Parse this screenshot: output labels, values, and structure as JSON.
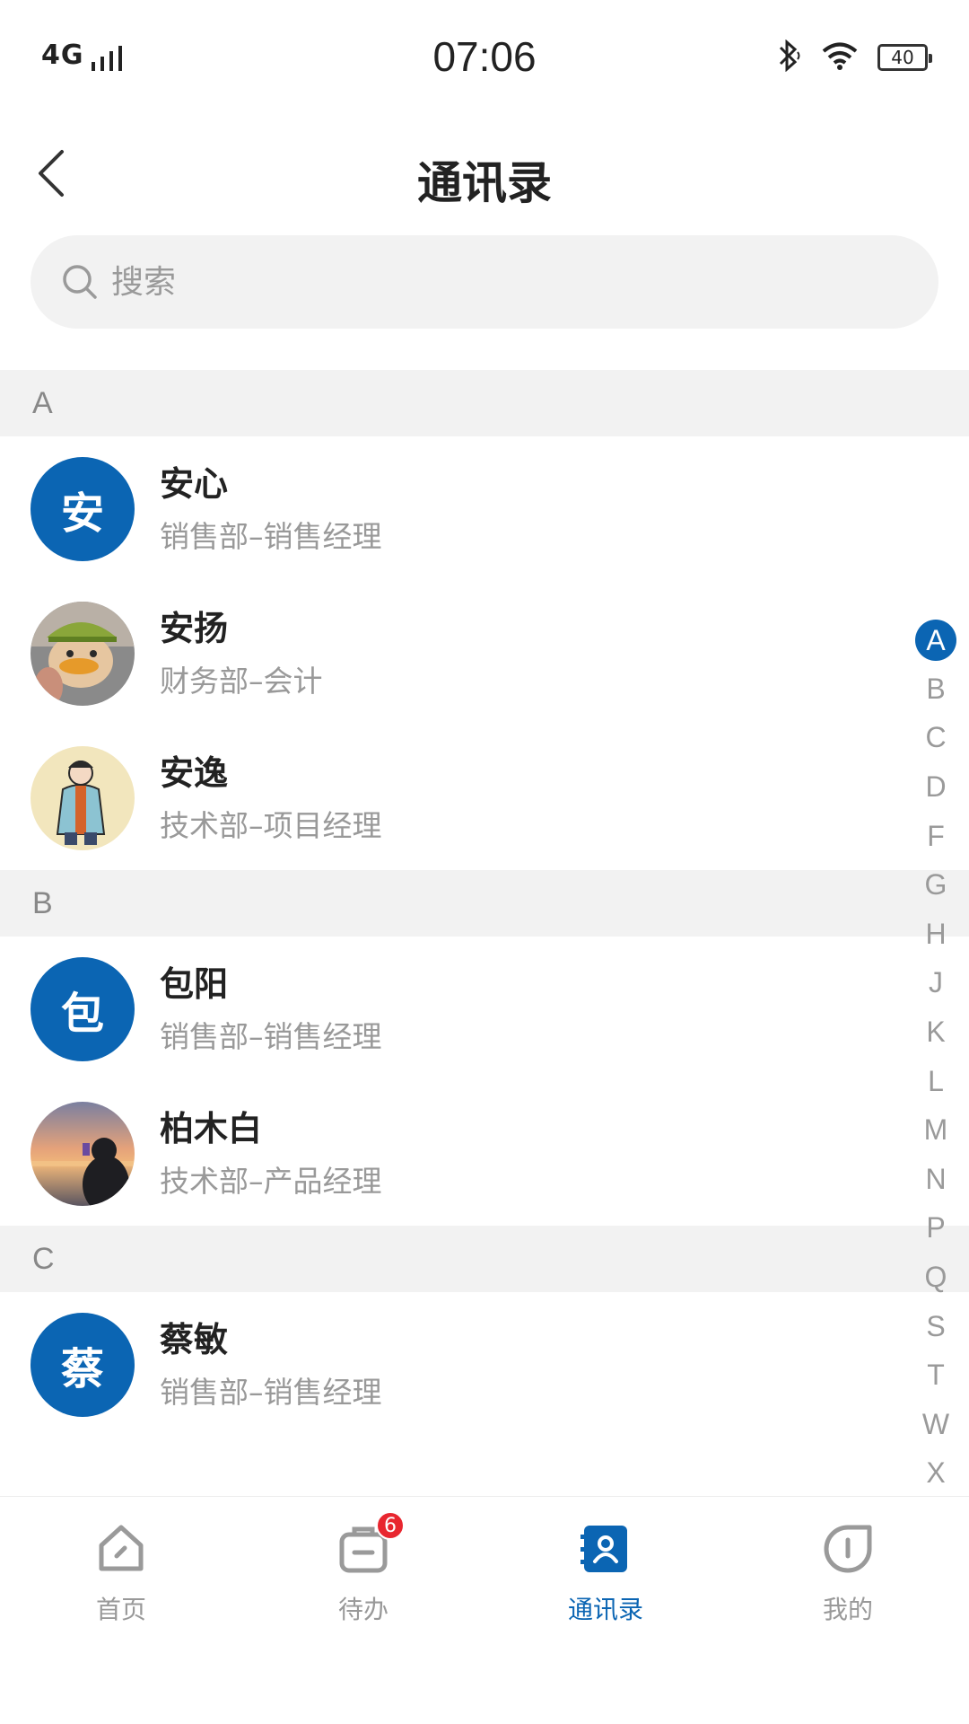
{
  "status_bar": {
    "network": "4G",
    "time": "07:06",
    "battery": "40"
  },
  "header": {
    "title": "通讯录"
  },
  "search": {
    "placeholder": "搜索"
  },
  "sections": [
    {
      "letter": "A",
      "contacts": [
        {
          "name": "安心",
          "dept": "销售部–销售经理",
          "avatar_text": "安"
        },
        {
          "name": "安扬",
          "dept": "财务部–会计",
          "avatar_text": ""
        },
        {
          "name": "安逸",
          "dept": "技术部–项目经理",
          "avatar_text": ""
        }
      ]
    },
    {
      "letter": "B",
      "contacts": [
        {
          "name": "包阳",
          "dept": "销售部–销售经理",
          "avatar_text": "包"
        },
        {
          "name": "柏木白",
          "dept": "技术部–产品经理",
          "avatar_text": ""
        }
      ]
    },
    {
      "letter": "C",
      "contacts": [
        {
          "name": "蔡敏",
          "dept": "销售部–销售经理",
          "avatar_text": "蔡"
        }
      ]
    }
  ],
  "index_letters": [
    "A",
    "B",
    "C",
    "D",
    "F",
    "G",
    "H",
    "J",
    "K",
    "L",
    "M",
    "N",
    "P",
    "Q",
    "S",
    "T",
    "W",
    "X"
  ],
  "active_index": "A",
  "tabs": [
    {
      "label": "首页",
      "icon": "home-icon"
    },
    {
      "label": "待办",
      "icon": "todo-icon",
      "badge": "6"
    },
    {
      "label": "通讯录",
      "icon": "contacts-icon",
      "active": true
    },
    {
      "label": "我的",
      "icon": "profile-icon"
    }
  ],
  "colors": {
    "accent": "#0b65b3",
    "badge": "#e8262f",
    "section_bg": "#f2f2f2"
  }
}
